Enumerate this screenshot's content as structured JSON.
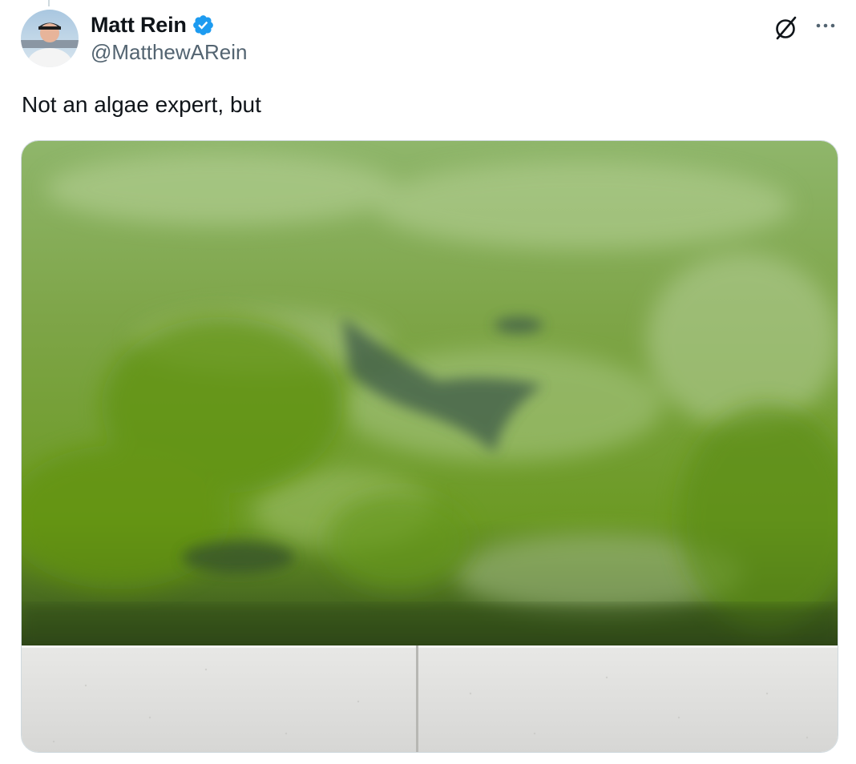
{
  "tweet": {
    "author": {
      "display_name": "Matt Rein",
      "handle": "@MatthewARein",
      "verified": true,
      "avatar_icon": "user-avatar"
    },
    "text": "Not an algae expert, but",
    "actions": {
      "grok_icon": "grok-slash-circle-icon",
      "more_icon": "ellipsis-icon"
    },
    "media": {
      "type": "photo",
      "alt": ""
    }
  },
  "colors": {
    "verified": "#1d9bf0",
    "text_primary": "#0f1419",
    "text_secondary": "#536471",
    "water": "#6e9a2c",
    "concrete": "#dcdcdc"
  }
}
